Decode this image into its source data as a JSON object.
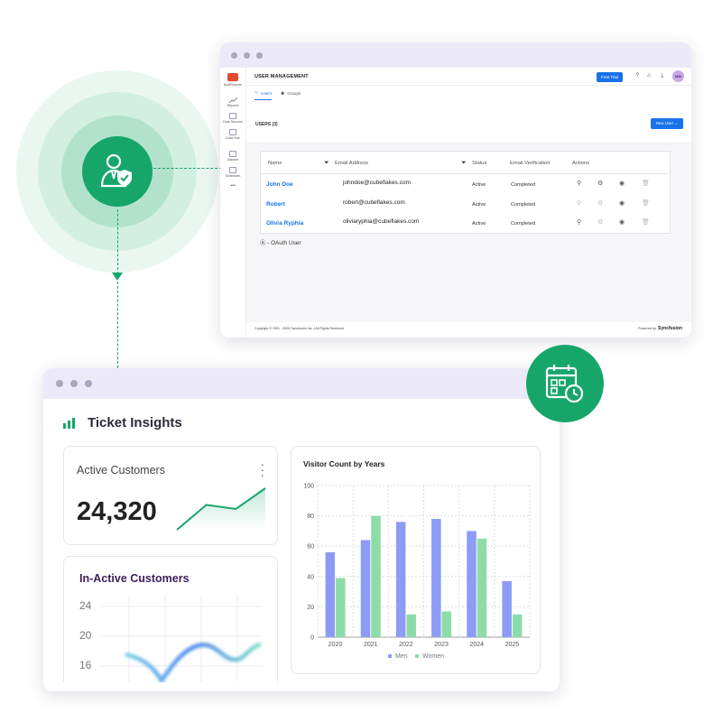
{
  "user_management_window": {
    "sidebar": {
      "logo_label": "BoldReports",
      "items": [
        {
          "label": "Reports",
          "icon": "chart-line-icon"
        },
        {
          "label": "Data Sources",
          "icon": "database-icon"
        },
        {
          "label": "Data Hub",
          "icon": "data-hub-icon"
        },
        {
          "label": "Dataset",
          "icon": "dataset-icon"
        },
        {
          "label": "Schedules",
          "icon": "schedule-icon"
        }
      ],
      "more_label": "•••"
    },
    "header": {
      "title": "USER MANAGEMENT",
      "free_trial_label": "Free Trial",
      "avatar_initials": "MM"
    },
    "tabs": [
      {
        "label": "Users",
        "active": true
      },
      {
        "label": "Groups",
        "active": false
      }
    ],
    "users_heading": "USERS (3)",
    "new_user_label": "New User",
    "table": {
      "columns": [
        "Name",
        "Email Address",
        "Status",
        "Email Verification",
        "Actions"
      ],
      "rows": [
        {
          "name": "John Doe",
          "email": "johndoe@cubeflakes.com",
          "status": "Active",
          "verification": "Completed"
        },
        {
          "name": "Robert",
          "email": "robert@cubeflakes.com",
          "status": "Active",
          "verification": "Completed"
        },
        {
          "name": "Olivia Ryphia",
          "email": "oliviaryphia@cubeflakes.com",
          "status": "Active",
          "verification": "Completed"
        }
      ]
    },
    "oauth_note": "- OAuth User",
    "footer": {
      "copyright": "Copyright © 2001 - 2026 Syncfusion Inc.  |  All Rights Reserved",
      "powered_by": "Powered by",
      "brand": "Syncfusion"
    }
  },
  "ticket_insights_window": {
    "title": "Ticket Insights",
    "active_customers": {
      "title": "Active Customers",
      "value": "24,320",
      "trend": [
        0.0,
        0.6,
        0.5,
        1.0
      ]
    },
    "inactive_customers": {
      "title": "In-Active Customers",
      "y_ticks": [
        "24",
        "20",
        "16"
      ]
    }
  },
  "colors": {
    "brand_green": "#16a66a",
    "accent_blue": "#1a73e8",
    "men_series": "#8c9cf6",
    "women_series": "#8ddca7"
  },
  "chart_data": {
    "type": "bar",
    "title": "Visitor Count by Years",
    "categories": [
      "2020",
      "2021",
      "2022",
      "2023",
      "2024",
      "2025"
    ],
    "series": [
      {
        "name": "Men",
        "values": [
          56,
          64,
          76,
          78,
          70,
          37
        ]
      },
      {
        "name": "Women",
        "values": [
          39,
          80,
          15,
          17,
          65,
          15
        ]
      }
    ],
    "y_ticks": [
      "0",
      "20",
      "40",
      "60",
      "80",
      "100"
    ],
    "ylim": [
      0,
      100
    ],
    "xlabel": "",
    "ylabel": "",
    "grid": true,
    "legend_position": "bottom"
  }
}
